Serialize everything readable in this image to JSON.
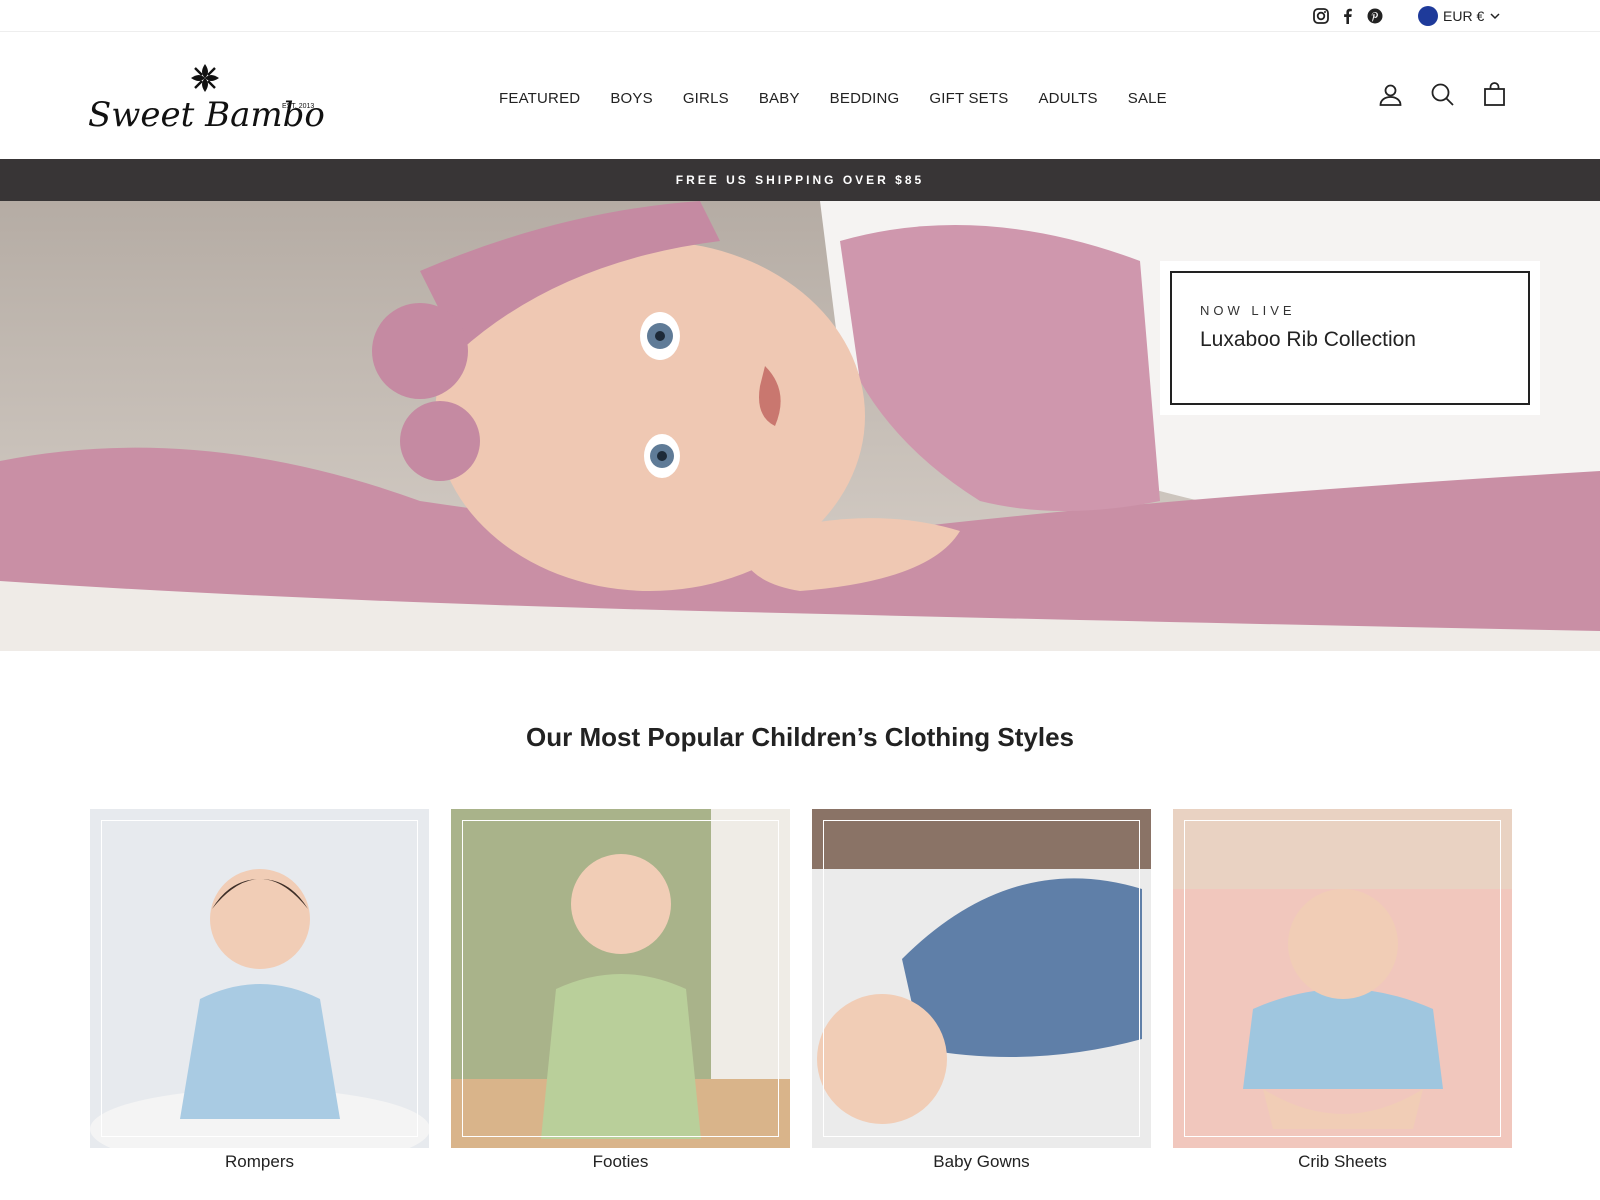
{
  "utility": {
    "social": [
      "instagram-icon",
      "facebook-icon",
      "pinterest-icon"
    ],
    "currency": "EUR €"
  },
  "header": {
    "logo_text": "Sweet Bamboo",
    "logo_est": "EST. 2013",
    "nav": [
      "FEATURED",
      "BOYS",
      "GIRLS",
      "BABY",
      "BEDDING",
      "GIFT SETS",
      "ADULTS",
      "SALE"
    ],
    "icons": [
      "user-icon",
      "search-icon",
      "cart-icon"
    ]
  },
  "announcement": "FREE US SHIPPING OVER $85",
  "hero": {
    "kicker": "NOW LIVE",
    "title": "Luxaboo Rib Collection"
  },
  "section": {
    "title": "Our Most Popular Children’s Clothing Styles",
    "cards": [
      {
        "label": "Rompers",
        "bg": "#e7eaee",
        "outfit": "#a9cbe3"
      },
      {
        "label": "Footies",
        "bg": "#a9b38a",
        "outfit": "#b9cf9a"
      },
      {
        "label": "Baby Gowns",
        "bg": "#ebebeb",
        "outfit": "#5f7fa8"
      },
      {
        "label": "Crib Sheets",
        "bg": "#f1c7bd",
        "outfit": "#9fc6df"
      }
    ]
  },
  "colors": {
    "announce_bg": "#383536",
    "hero_pink": "#c98fa5"
  }
}
